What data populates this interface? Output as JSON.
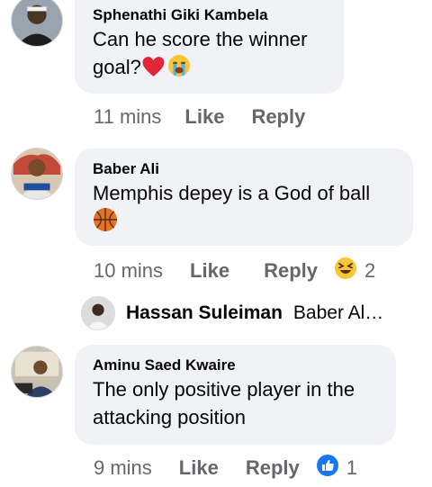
{
  "comments": [
    {
      "author": "Sphenathi Giki Kambela",
      "text_line1": "Can he score the winner",
      "text_line2": "goal?",
      "emojis": [
        "red-heart",
        "loudly-crying-face"
      ],
      "time": "11 mins",
      "like_label": "Like",
      "reply_label": "Reply"
    },
    {
      "author": "Baber Ali",
      "text_line1": "Memphis depey is a God of ball",
      "emojis": [
        "basketball"
      ],
      "time": "10 mins",
      "like_label": "Like",
      "reply_label": "Reply",
      "reaction": "haha",
      "reaction_count": "2"
    },
    {
      "author": "Aminu Saed Kwaire",
      "text_line1": "The only positive player in the",
      "text_line2": "attacking position",
      "time": "9 mins",
      "like_label": "Like",
      "reply_label": "Reply",
      "reaction": "like",
      "reaction_count": "1"
    }
  ],
  "reply_preview": {
    "author": "Hassan Suleiman",
    "snippet": "Baber Al…"
  },
  "colors": {
    "bubble": "#f0f2f5",
    "meta_text": "#65676b",
    "like_blue": "#1877f2",
    "haha_yellow": "#f7c737"
  }
}
